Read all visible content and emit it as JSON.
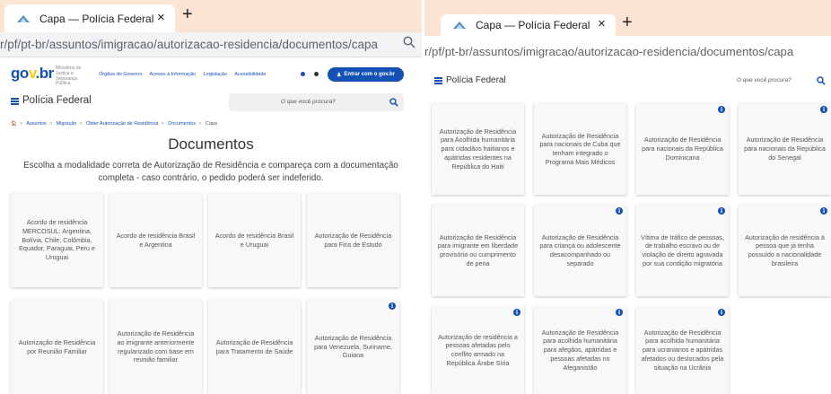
{
  "left": {
    "tab": {
      "title": "Capa — Polícia Federal",
      "close": "×",
      "new_tab": "+"
    },
    "url": "r/pf/pt-br/assuntos/imigracao/autorizacao-residencia/documentos/capa",
    "gov_header": {
      "logo_parts": [
        "go",
        "v",
        ".",
        "br"
      ],
      "ministry": "Ministério da Justiça e Segurança Pública",
      "links": [
        "Órgãos do Governo",
        "Acesso à Informação",
        "Legislação",
        "Acessibilidade"
      ],
      "login_label": "Entrar com o gov.br"
    },
    "site_name": "Polícia Federal",
    "search_placeholder": "O que você procura?",
    "breadcrumb": [
      "Assuntos",
      "Migração",
      "Obter Autorização de Residência",
      "Documentos",
      "Capa"
    ],
    "page_title": "Documentos",
    "intro": "Escolha a modalidade correta de Autorização de Residência e compareça com a documentação completa - caso contrário, o pedido poderá ser indeferido.",
    "cards": [
      {
        "label": "Acordo de residência MERCOSUL: Argentina, Bolívia, Chile, Colômbia, Equador, Paraguai, Peru e Uruguai",
        "info": false
      },
      {
        "label": "Acordo de residência Brasil e Argentina",
        "info": false
      },
      {
        "label": "Acordo de residência Brasil e Uruguai",
        "info": false
      },
      {
        "label": "Autorização de Residência para Fins de Estudo",
        "info": false
      },
      {
        "label": "Autorização de Residência por Reunião Familiar",
        "info": false
      },
      {
        "label": "Autorização de Residência ao imigrante anteriormente regularizado com base em reunião familiar",
        "info": false
      },
      {
        "label": "Autorização de Residência para Tratamento de Saúde",
        "info": false
      },
      {
        "label": "Autorização de Residência para Venezuela, Suriname, Guiana",
        "info": true
      }
    ]
  },
  "right": {
    "tab": {
      "title": "Capa — Polícia Federal",
      "close": "×",
      "new_tab": "+"
    },
    "url": "r/pf/pt-br/assuntos/imigracao/autorizacao-residencia/documentos/capa",
    "site_name": "Polícia Federal",
    "search_placeholder": "O que você procura?",
    "cards": [
      {
        "label": "Autorização de Residência para Acolhida humanitária para cidadãos haitianos e apátridas residentes na República do Haiti",
        "info": false
      },
      {
        "label": "Autorização de Residência para nacionais de Cuba que tenham integrado o Programa Mais Médicos",
        "info": false
      },
      {
        "label": "Autorização de Residência para nacionais da República Dominicana",
        "info": true
      },
      {
        "label": "Autorização de Residência para nacionais da República do Senegal",
        "info": true
      },
      {
        "label": "Autorização de Residência para imigrante em liberdade provisória ou cumprimento de pena",
        "info": false
      },
      {
        "label": "Autorização de Residência para criança ou adolescente desacompanhado ou separado",
        "info": true
      },
      {
        "label": "Vítima de tráfico de pessoas, de trabalho escravo ou de violação de direito agravada por sua condição migratória",
        "info": true
      },
      {
        "label": "Autorização de residência à pessoa que já tenha possuído a nacionalidade brasileira",
        "info": true
      },
      {
        "label": "Autorização de residência a pessoas afetadas pelo conflito armado na República Árabe Síria",
        "info": true
      },
      {
        "label": "Autorização de Residência para acolhida humanitária para afegãos, apátridas e pessoas afetadas no Afeganistão",
        "info": true
      },
      {
        "label": "Autorização de Residência para acolhida humanitária para ucranianos e apátridas afetados ou deslocados pela situação na Ucrânia",
        "info": true
      }
    ]
  },
  "colors": {
    "tab_strip": "#fbe4d4",
    "gov_blue": "#1351b4",
    "card_bg": "#f8f8f8"
  },
  "icons": [
    "favicon-icon",
    "close-icon",
    "plus-icon",
    "search-icon",
    "menu-icon",
    "user-icon",
    "info-icon",
    "home-icon",
    "chevron-right-icon",
    "contrast-icon",
    "cookie-icon"
  ]
}
